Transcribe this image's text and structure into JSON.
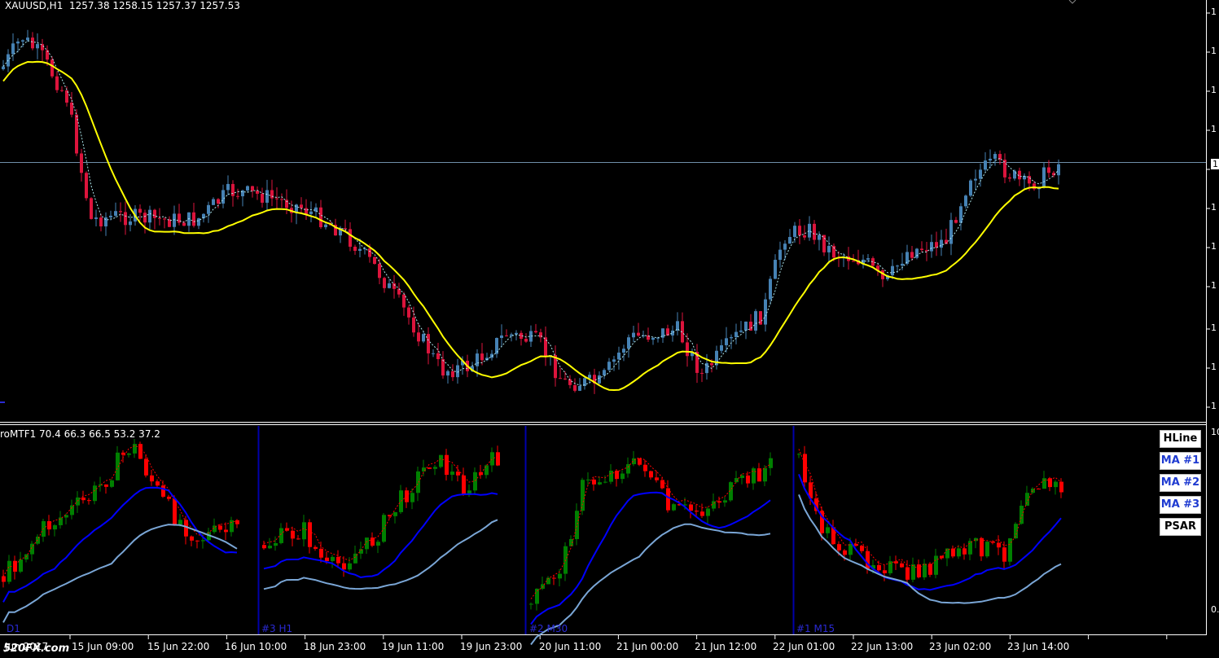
{
  "header": {
    "symbol_line": "XAUUSD,H1  1257.38 1258.15 1257.37 1257.53",
    "indicator_line": "roMTF1 70.4 66.3 66.5 53.2 37.2"
  },
  "buttons": [
    {
      "label": "HLine",
      "style": "black"
    },
    {
      "label": "MA #1",
      "style": "blue"
    },
    {
      "label": "MA #2",
      "style": "blue"
    },
    {
      "label": "MA #3",
      "style": "blue"
    },
    {
      "label": "PSAR",
      "style": "black"
    }
  ],
  "time_axis": [
    "15 Jun 09:00",
    "15 Jun 22:00",
    "16 Jun 10:00",
    "18 Jun 23:00",
    "19 Jun 11:00",
    "19 Jun 23:00",
    "20 Jun 11:00",
    "21 Jun 00:00",
    "21 Jun 12:00",
    "22 Jun 01:00",
    "22 Jun 13:00",
    "23 Jun 02:00",
    "23 Jun 14:00"
  ],
  "price_axis_main": [
    "1",
    "1",
    "1",
    "1",
    "1",
    "1",
    "1",
    "1",
    "1",
    "1",
    "1"
  ],
  "price_axis_sub": [
    "10",
    "0."
  ],
  "timeframe_labels": [
    "D1",
    "#3 H1",
    "#2 M30",
    "#1 M15"
  ],
  "watermark": "520FX.com",
  "first_date_partial": "Jun 2017",
  "colors": {
    "bull": "#4682b4",
    "bear": "#dc143c",
    "ma_yellow": "#ffff00",
    "ma_dotted": "#aee8ee",
    "sub_bull": "#008000",
    "sub_bear": "#ff0000",
    "sub_ma_fast": "#0000ff",
    "sub_ma_slow": "#7aa6d6",
    "separator": "#0000aa"
  },
  "chart_data": {
    "type": "candlestick",
    "symbol": "XAUUSD",
    "timeframe": "H1",
    "last_bar": {
      "open": 1257.38,
      "high": 1258.15,
      "low": 1257.37,
      "close": 1257.53
    },
    "indicator_values": [
      70.4,
      66.3,
      66.5,
      53.2,
      37.2
    ]
  }
}
